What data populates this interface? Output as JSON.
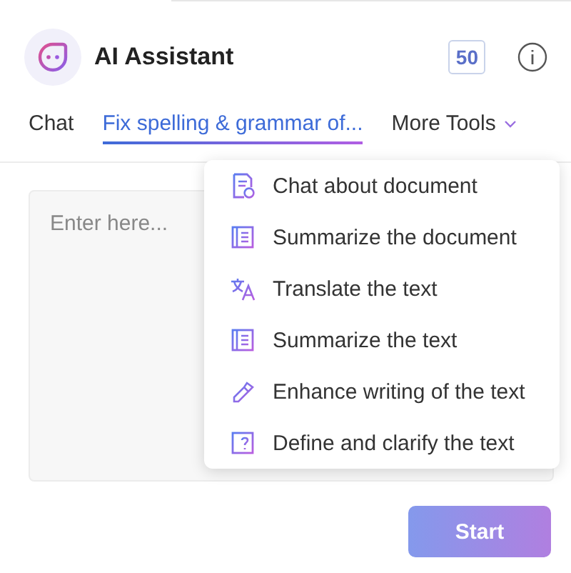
{
  "header": {
    "title": "AI Assistant",
    "credits": "50"
  },
  "tabs": [
    {
      "label": "Chat",
      "selected": false
    },
    {
      "label": "Fix spelling & grammar of...",
      "selected": true
    },
    {
      "label": "More Tools",
      "selected": false,
      "kind": "dropdown"
    }
  ],
  "input": {
    "placeholder": "Enter here..."
  },
  "menu": [
    {
      "label": "Chat about document",
      "kind": "doc-chat"
    },
    {
      "label": "Summarize the document",
      "kind": "summary"
    },
    {
      "label": "Translate the text",
      "kind": "translate"
    },
    {
      "label": "Summarize the text",
      "kind": "summary"
    },
    {
      "label": "Enhance writing of the text",
      "kind": "pen"
    },
    {
      "label": "Define and clarify the text",
      "kind": "question"
    }
  ],
  "start_button": {
    "label": "Start",
    "disabled": true
  }
}
